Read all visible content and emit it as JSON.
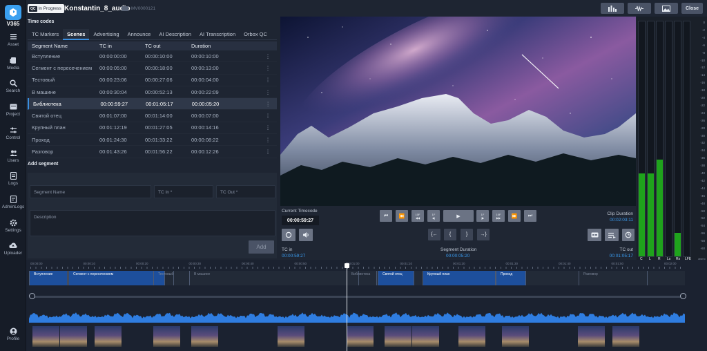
{
  "app": {
    "logo_text": "V365"
  },
  "sidebar": {
    "items": [
      {
        "label": "Asset",
        "icon": "asset-icon"
      },
      {
        "label": "Media",
        "icon": "media-icon"
      },
      {
        "label": "Search",
        "icon": "search-icon"
      },
      {
        "label": "Project",
        "icon": "project-icon"
      },
      {
        "label": "Control",
        "icon": "control-icon"
      },
      {
        "label": "Users",
        "icon": "users-icon"
      },
      {
        "label": "Logs",
        "icon": "logs-icon"
      },
      {
        "label": "AdminLogs",
        "icon": "adminlogs-icon"
      },
      {
        "label": "Settings",
        "icon": "settings-icon"
      },
      {
        "label": "Uploader",
        "icon": "uploader-icon"
      }
    ],
    "profile_label": "Profile"
  },
  "header": {
    "status_badge_icon": "QC",
    "status_badge": "In Progress",
    "title": "Konstantin_8_audio",
    "asset_id": "MV0000121",
    "close_label": "Close"
  },
  "timecodes": {
    "heading": "Time codes",
    "tabs": [
      "TC Markers",
      "Scenes",
      "Advertising",
      "Announce",
      "AI Description",
      "AI Transcription",
      "Orbox QC"
    ],
    "active_tab": "Scenes",
    "columns": [
      "Segment Name",
      "TC in",
      "TC out",
      "Duration"
    ],
    "rows": [
      {
        "name": "Вступление",
        "tc_in": "00:00:00:00",
        "tc_out": "00:00:10:00",
        "duration": "00:00:10:00"
      },
      {
        "name": "Сегмент с пересечением",
        "tc_in": "00:00:05:00",
        "tc_out": "00:00:18:00",
        "duration": "00:00:13:00"
      },
      {
        "name": "Тестовый",
        "tc_in": "00:00:23:06",
        "tc_out": "00:00:27:06",
        "duration": "00:00:04:00"
      },
      {
        "name": "В машине",
        "tc_in": "00:00:30:04",
        "tc_out": "00:00:52:13",
        "duration": "00:00:22:09"
      },
      {
        "name": "Библиотека",
        "tc_in": "00:00:59:27",
        "tc_out": "00:01:05:17",
        "duration": "00:00:05:20"
      },
      {
        "name": "Святой отец",
        "tc_in": "00:01:07:00",
        "tc_out": "00:01:14:00",
        "duration": "00:00:07:00"
      },
      {
        "name": "Крупный план",
        "tc_in": "00:01:12:19",
        "tc_out": "00:01:27:05",
        "duration": "00:00:14:16"
      },
      {
        "name": "Проход",
        "tc_in": "00:01:24:30",
        "tc_out": "00:01:33:22",
        "duration": "00:00:08:22"
      },
      {
        "name": "Разговор",
        "tc_in": "00:01:43:26",
        "tc_out": "00:01:56:22",
        "duration": "00:00:12:26"
      }
    ],
    "selected_row": 4
  },
  "add_segment": {
    "heading": "Add segment",
    "name_placeholder": "Segment Name",
    "tc_in_placeholder": "TC In *",
    "tc_out_placeholder": "TC Out *",
    "description_placeholder": "Description",
    "add_label": "Add"
  },
  "player": {
    "current_tc_label": "Current Timecode",
    "current_tc": "00:00:59:27",
    "clip_duration_label": "Clip Duration",
    "clip_duration": "00:02:03:11",
    "tc_in_label": "TC in",
    "tc_in": "00:00:59:27",
    "segment_duration_label": "Segment Duration",
    "segment_duration": "00:00:05:20",
    "tc_out_label": "TC out",
    "tc_out": "00:01:05:17",
    "step_labels": {
      "back_10f": "10F",
      "back_1f": "1F",
      "fwd_1f": "1F",
      "fwd_10f": "10F"
    }
  },
  "meters": {
    "channels": [
      {
        "label": "C",
        "level": 0.35
      },
      {
        "label": "L",
        "level": 0.35
      },
      {
        "label": "R",
        "level": 0.41
      },
      {
        "label": "Ls",
        "level": 0.0
      },
      {
        "label": "Rs",
        "level": 0.1
      },
      {
        "label": "LFE",
        "level": 0.0
      }
    ],
    "unit": "dBFS",
    "ticks": [
      "0",
      "-2",
      "-4",
      "-6",
      "-8",
      "-10",
      "-12",
      "-14",
      "-16",
      "-18",
      "-20",
      "-22",
      "-24",
      "-26",
      "-28",
      "-30",
      "-32",
      "-34",
      "-36",
      "-38",
      "-40",
      "-42",
      "-44",
      "-46",
      "-48",
      "-50",
      "-52",
      "-54",
      "-56",
      "-58",
      "-60"
    ],
    "color": "#1fa31c"
  },
  "timeline": {
    "ruler": [
      "00:00:00",
      "00:00:10",
      "00:00:20",
      "00:00:30",
      "00:00:40",
      "00:00:50",
      "00:01:00",
      "00:01:10",
      "00:01:20",
      "00:01:30",
      "00:01:40",
      "00:01:50",
      "00:02:00"
    ],
    "segments": [
      {
        "label": "Вступление",
        "active": true
      },
      {
        "label": "Сегмент с пересечением",
        "active": true
      },
      {
        "label": "Тестовый",
        "active": false
      },
      {
        "label": "В машине",
        "active": false
      },
      {
        "label": "Библиотека",
        "active": false
      },
      {
        "label": "Святой отец",
        "active": true
      },
      {
        "label": "Крупный план",
        "active": true
      },
      {
        "label": "Проход",
        "active": true
      },
      {
        "label": "Разговор",
        "active": false
      }
    ],
    "accent": "#3a8fe0"
  }
}
